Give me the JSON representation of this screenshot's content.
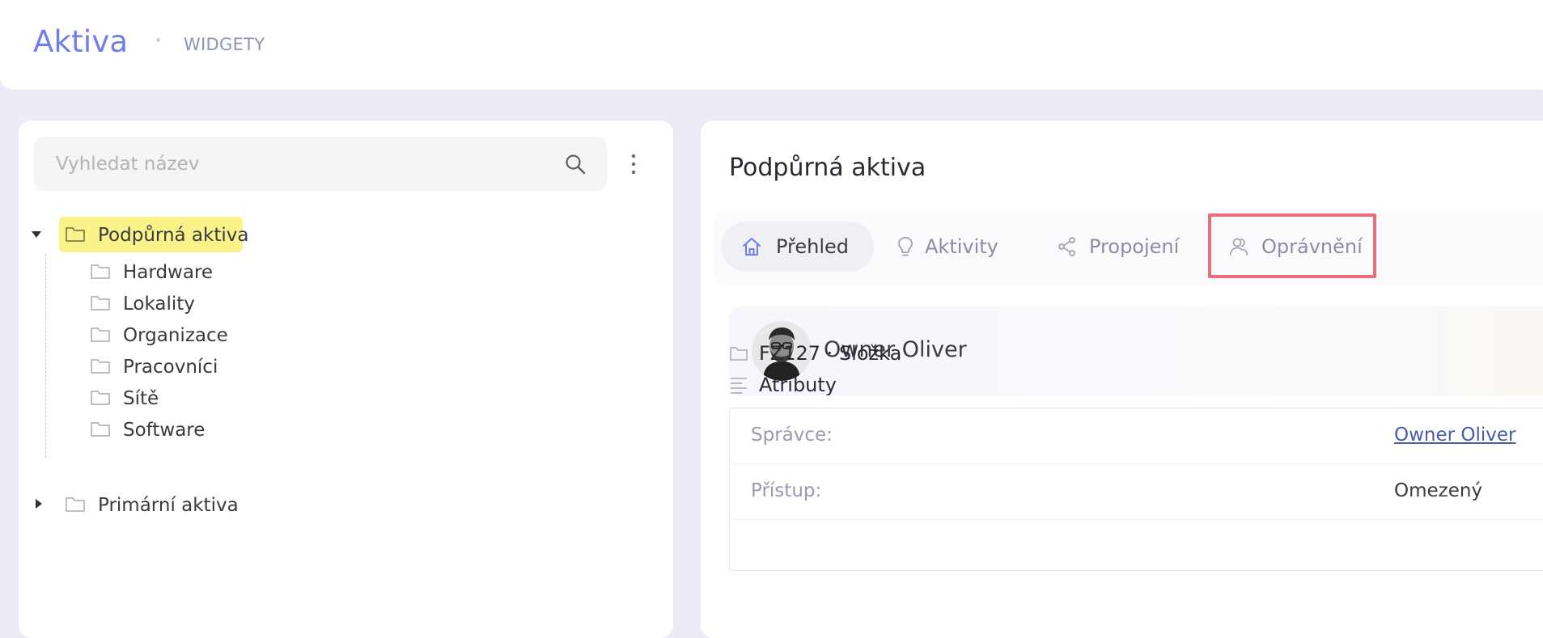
{
  "header": {
    "title": "Aktiva",
    "breadcrumb": "WIDGETY"
  },
  "tree_panel": {
    "search": {
      "placeholder": "Vyhledat název",
      "value": ""
    },
    "nodes": [
      {
        "label": "Podpůrná aktiva",
        "expanded": true,
        "selected": true,
        "children": [
          "Hardware",
          "Lokality",
          "Organizace",
          "Pracovníci",
          "Sítě",
          "Software"
        ]
      },
      {
        "label": "Primární aktiva",
        "expanded": false,
        "selected": false
      }
    ]
  },
  "detail_panel": {
    "title": "Podpůrná aktiva",
    "tabs": [
      {
        "label": "Přehled",
        "icon": "home-icon",
        "active": true
      },
      {
        "label": "Aktivity",
        "icon": "lightbulb-icon",
        "active": false
      },
      {
        "label": "Propojení",
        "icon": "share-icon",
        "active": false
      },
      {
        "label": "Oprávnění",
        "icon": "users-icon",
        "active": false,
        "highlighted": true
      }
    ],
    "owner": {
      "name": "Owner Oliver"
    },
    "folder_line": "FZ127 · Složka",
    "attributes_heading": "Atributy",
    "attributes": [
      {
        "label": "Správce:",
        "value": "Owner Oliver",
        "is_link": true
      },
      {
        "label": "Přístup:",
        "value": "Omezený",
        "is_link": false
      }
    ]
  },
  "colors": {
    "accent": "#6e7ee8",
    "selected_highlight": "#fbf38a",
    "annotation_box": "#ea6f7b",
    "background": "#ececf7"
  }
}
